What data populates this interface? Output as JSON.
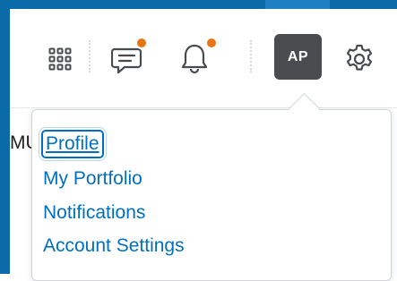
{
  "navbar": {
    "avatar_initials": "AP",
    "icons": [
      "apps-grid-icon",
      "message-alert-icon",
      "bell-icon",
      "gear-icon"
    ],
    "notification_dot_color": "#e87511"
  },
  "background": {
    "truncated_text": "MU"
  },
  "profile_menu": {
    "items": [
      {
        "label": "Profile"
      },
      {
        "label": "My Portfolio"
      },
      {
        "label": "Notifications"
      },
      {
        "label": "Account Settings"
      }
    ]
  },
  "colors": {
    "frame": "#0b6aa8",
    "link": "#006fbf",
    "avatar_bg": "#494c4e"
  }
}
